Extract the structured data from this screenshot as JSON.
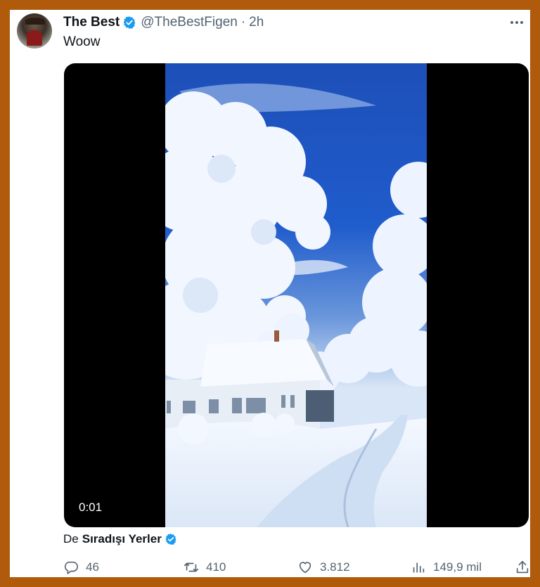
{
  "tweet": {
    "author_name": "The Best",
    "handle": "@TheBestFigen",
    "separator": "·",
    "time": "2h",
    "text": "Woow",
    "video_time": "0:01",
    "attribution_prefix": "De",
    "attribution_source": "Sıradışı Yerler"
  },
  "actions": {
    "replies": "46",
    "retweets": "410",
    "likes": "3.812",
    "views": "149,9 mil"
  },
  "colors": {
    "verified": "#1d9bf0",
    "muted": "#536471",
    "frame": "#b05a0c"
  },
  "icons": [
    "verified-badge-icon",
    "more-icon",
    "reply-icon",
    "retweet-icon",
    "like-icon",
    "views-icon",
    "share-icon"
  ]
}
